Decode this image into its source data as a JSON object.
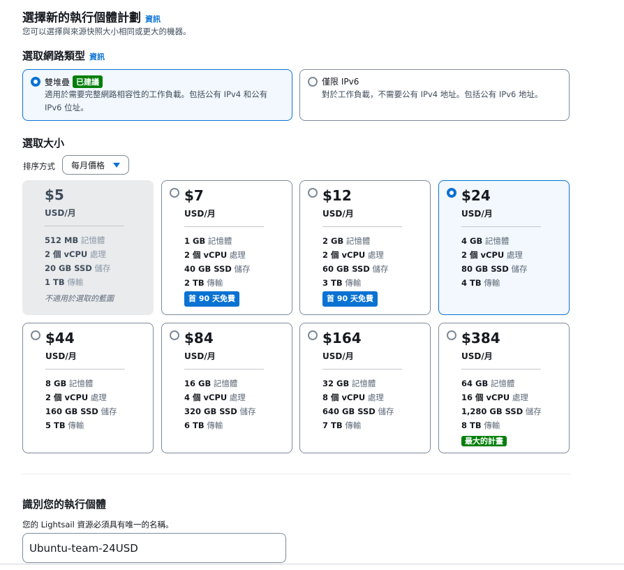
{
  "header": {
    "title": "選擇新的執行個體計劃",
    "info": "資訊",
    "subtitle": "您可以選擇與來源快照大小相同或更大的機器。"
  },
  "network": {
    "title": "選取網路類型",
    "info": "資訊",
    "options": [
      {
        "label": "雙堆疊",
        "badge": "已建議",
        "desc": "適用於需要完整網路相容性的工作負載。包括公有 IPv4 和公有 IPv6 位址。",
        "selected": true
      },
      {
        "label": "僅限 IPv6",
        "badge": "",
        "desc": "對於工作負載，不需要公有 IPv4 地址。包括公有 IPv6 地址。",
        "selected": false
      }
    ]
  },
  "size": {
    "title": "選取大小",
    "sort_label": "排序方式",
    "sort_value": "每月價格"
  },
  "plans": [
    {
      "price": "$5",
      "period": "USD/月",
      "mem": "512 MB",
      "mem_label": "記憶體",
      "cpu": "2 個 vCPU",
      "cpu_label": "處理",
      "ssd": "20 GB SSD",
      "ssd_label": "儲存",
      "transfer": "1 TB",
      "transfer_label": "傳輸",
      "badge": "",
      "note": "不適用於選取的藍圖",
      "state": "disabled"
    },
    {
      "price": "$7",
      "period": "USD/月",
      "mem": "1 GB",
      "mem_label": "記憶體",
      "cpu": "2 個 vCPU",
      "cpu_label": "處理",
      "ssd": "40 GB SSD",
      "ssd_label": "儲存",
      "transfer": "2 TB",
      "transfer_label": "傳輸",
      "badge": "首 90 天免費",
      "note": "",
      "state": "normal"
    },
    {
      "price": "$12",
      "period": "USD/月",
      "mem": "2 GB",
      "mem_label": "記憶體",
      "cpu": "2 個 vCPU",
      "cpu_label": "處理",
      "ssd": "60 GB SSD",
      "ssd_label": "儲存",
      "transfer": "3 TB",
      "transfer_label": "傳輸",
      "badge": "首 90 天免費",
      "note": "",
      "state": "normal"
    },
    {
      "price": "$24",
      "period": "USD/月",
      "mem": "4 GB",
      "mem_label": "記憶體",
      "cpu": "2 個 vCPU",
      "cpu_label": "處理",
      "ssd": "80 GB SSD",
      "ssd_label": "儲存",
      "transfer": "4 TB",
      "transfer_label": "傳輸",
      "badge": "",
      "note": "",
      "state": "selected"
    },
    {
      "price": "$44",
      "period": "USD/月",
      "mem": "8 GB",
      "mem_label": "記憶體",
      "cpu": "2 個 vCPU",
      "cpu_label": "處理",
      "ssd": "160 GB SSD",
      "ssd_label": "儲存",
      "transfer": "5 TB",
      "transfer_label": "傳輸",
      "badge": "",
      "note": "",
      "state": "normal"
    },
    {
      "price": "$84",
      "period": "USD/月",
      "mem": "16 GB",
      "mem_label": "記憶體",
      "cpu": "4 個 vCPU",
      "cpu_label": "處理",
      "ssd": "320 GB SSD",
      "ssd_label": "儲存",
      "transfer": "6 TB",
      "transfer_label": "傳輸",
      "badge": "",
      "note": "",
      "state": "normal"
    },
    {
      "price": "$164",
      "period": "USD/月",
      "mem": "32 GB",
      "mem_label": "記憶體",
      "cpu": "8 個 vCPU",
      "cpu_label": "處理",
      "ssd": "640 GB SSD",
      "ssd_label": "儲存",
      "transfer": "7 TB",
      "transfer_label": "傳輸",
      "badge": "",
      "note": "",
      "state": "normal"
    },
    {
      "price": "$384",
      "period": "USD/月",
      "mem": "64 GB",
      "mem_label": "記憶體",
      "cpu": "16 個 vCPU",
      "cpu_label": "處理",
      "ssd": "1,280 GB SSD",
      "ssd_label": "儲存",
      "transfer": "8 TB",
      "transfer_label": "傳輸",
      "badge": "最大的計畫",
      "note": "",
      "state": "normal"
    }
  ],
  "identify": {
    "title": "識別您的執行個體",
    "desc": "您的 Lightsail 資源必須具有唯一的名稱。",
    "value": "Ubuntu-team-24USD"
  },
  "colors": {
    "accent": "#0972d3",
    "success": "#037f0c",
    "selected_bg": "#f2f8fd",
    "disabled_bg": "#e9ebed"
  }
}
